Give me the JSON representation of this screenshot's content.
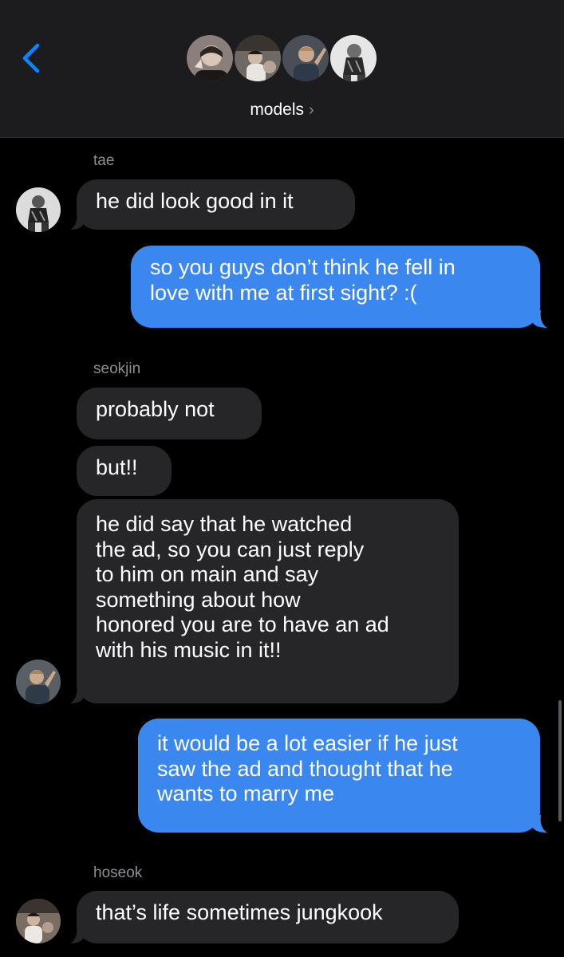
{
  "header": {
    "group_name": "models",
    "chevron": "›",
    "back_icon": "chevron-left-icon",
    "accent": "#0a84ff",
    "participants": [
      "avatar-1",
      "avatar-2",
      "avatar-3",
      "avatar-4"
    ]
  },
  "messages": [
    {
      "sender": "tae",
      "text": "he did look good in it",
      "direction": "incoming"
    },
    {
      "text": "so you guys don’t think he fell in\nlove with me at first sight? :(",
      "direction": "outgoing"
    },
    {
      "sender": "seokjin",
      "text": "probably not",
      "direction": "incoming"
    },
    {
      "text": "but!!",
      "direction": "incoming"
    },
    {
      "text": "he did say that he watched\nthe ad, so you can just reply\nto him on main and say\nsomething about how\nhonored you are to have an ad\nwith his music in it!!",
      "direction": "incoming"
    },
    {
      "text": "it would be a lot easier if he just\nsaw the ad and thought that he\nwants to marry me",
      "direction": "outgoing"
    },
    {
      "sender": "hoseok",
      "text": "that’s life sometimes jungkook",
      "direction": "incoming"
    }
  ],
  "colors": {
    "incoming_bubble": "#262629",
    "outgoing_bubble": "#3b87f0",
    "header_bg": "#1c1c1e"
  }
}
